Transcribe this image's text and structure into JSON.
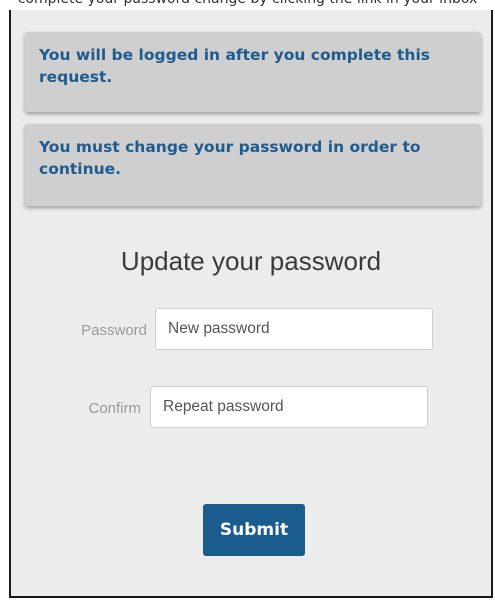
{
  "caption": "complete your password change by clicking the link in your inbox",
  "alerts": [
    {
      "text": "You will be logged in after you complete this request."
    },
    {
      "text": "You must change your password in order to continue."
    }
  ],
  "form": {
    "title": "Update your password",
    "password_label": "Password",
    "password_placeholder": "New password",
    "confirm_label": "Confirm",
    "confirm_placeholder": "Repeat password",
    "submit_label": "Submit"
  },
  "colors": {
    "alert_text": "#1f5b8e",
    "alert_background": "#cfcfcf",
    "panel_background": "#ececec",
    "submit_background": "#1b5c8f"
  }
}
